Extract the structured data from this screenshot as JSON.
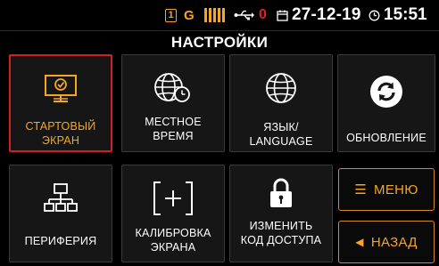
{
  "status": {
    "sim": "1",
    "network": "G",
    "counter": "0",
    "date": "27-12-19",
    "time": "15:51",
    "icons": [
      "sim-icon",
      "signal-bars-icon",
      "usb-icon",
      "calendar-icon",
      "clock-icon"
    ]
  },
  "title": "НАСТРОЙКИ",
  "tiles": [
    {
      "line1": "СТАРТОВЫЙ",
      "line2": "ЭКРАН",
      "icon": "start-screen-monitor-icon",
      "selected": true
    },
    {
      "line1": "МЕСТНОЕ",
      "line2": "ВРЕМЯ",
      "icon": "globe-clock-icon",
      "selected": false
    },
    {
      "line1": "ЯЗЫК/",
      "line2": "LANGUAGE",
      "icon": "globe-icon",
      "selected": false
    },
    {
      "line1": "ОБНОВЛЕНИЕ",
      "line2": "",
      "icon": "refresh-icon",
      "selected": false
    },
    {
      "line1": "ПЕРИФЕРИЯ",
      "line2": "",
      "icon": "network-tree-icon",
      "selected": false
    },
    {
      "line1": "КАЛИБРОВКА",
      "line2": "ЭКРАНА",
      "icon": "calibration-crosshair-icon",
      "selected": false
    },
    {
      "line1": "ИЗМЕНИТЬ",
      "line2": "КОД ДОСТУПА",
      "icon": "padlock-icon",
      "selected": false
    }
  ],
  "buttons": {
    "menu_symbol": "☰",
    "menu_label": "МЕНЮ",
    "back_symbol": "◀",
    "back_label": "НАЗАД"
  },
  "colors": {
    "accent": "#f5a623",
    "selected_border": "#d11f23",
    "counter": "#e0201d",
    "tile_bg": "#161616"
  }
}
